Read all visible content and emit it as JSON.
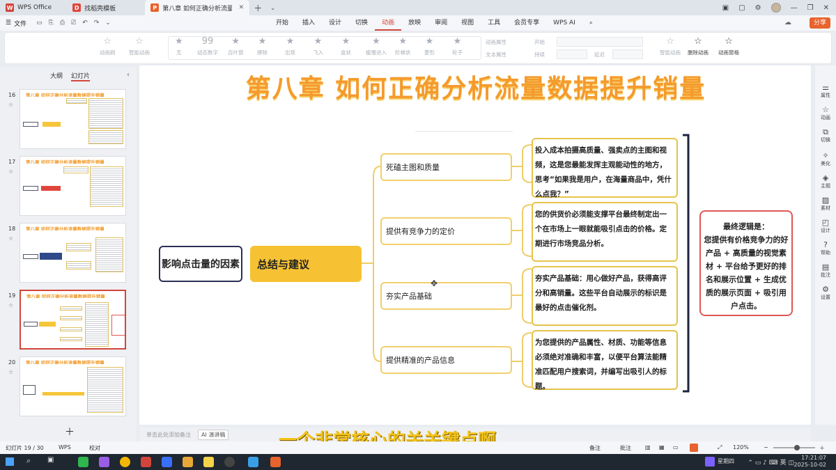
{
  "tabs": [
    {
      "label": "WPS Office",
      "logo": "W",
      "color": "#d2453a"
    },
    {
      "label": "找稻壳模板",
      "logo": "D",
      "color": "#e0453d"
    },
    {
      "label": "第八章 如何正确分析流量数据",
      "logo": "P",
      "color": "#e8632d",
      "active": true
    }
  ],
  "menu": {
    "file": "文件",
    "tabs": [
      "开始",
      "插入",
      "设计",
      "切换",
      "动画",
      "放映",
      "审阅",
      "视图",
      "工具",
      "会员专享",
      "WPS AI"
    ],
    "active": "动画",
    "share": "分享"
  },
  "ribbon": {
    "items": [
      {
        "label": "动画刷",
        "icon": "☆",
        "enabled": false
      },
      {
        "label": "智能动画",
        "icon": "☆",
        "enabled": false
      },
      {
        "label": "无",
        "icon": "☆",
        "enabled": false
      },
      {
        "label": "动态数字",
        "icon": "99",
        "enabled": false
      },
      {
        "label": "百叶窗",
        "icon": "★",
        "enabled": false
      },
      {
        "label": "擦除",
        "icon": "★",
        "enabled": false
      },
      {
        "label": "出现",
        "icon": "★",
        "enabled": false
      },
      {
        "label": "飞入",
        "icon": "★",
        "enabled": false
      },
      {
        "label": "盒状",
        "icon": "★",
        "enabled": false
      },
      {
        "label": "缓慢进入",
        "icon": "★",
        "enabled": false
      },
      {
        "label": "阶梯状",
        "icon": "★",
        "enabled": false
      },
      {
        "label": "菱形",
        "icon": "★",
        "enabled": false
      },
      {
        "label": "轮子",
        "icon": "★",
        "enabled": false
      }
    ],
    "effect_attr": "动画属性",
    "text_attr": "文本属性",
    "start": "开始",
    "duration": "持续",
    "delay": "延迟",
    "right": [
      {
        "label": "智能动画",
        "icon": "☆",
        "enabled": false
      },
      {
        "label": "删除动画",
        "icon": "☆",
        "enabled": true
      },
      {
        "label": "动画窗格",
        "icon": "☆",
        "enabled": true
      }
    ]
  },
  "leftpanel": {
    "tab_outline": "大纲",
    "tab_slides": "幻灯片",
    "thumb_title": "第八章 如何正确分析流量数据提升销量",
    "slides": [
      16,
      17,
      18,
      19,
      20
    ],
    "selected": 19
  },
  "slide": {
    "title": "第八章 如何正确分析流量数据提升销量",
    "root": "影响点击量的因素",
    "middle": "总结与建议",
    "branches": [
      {
        "label": "死磕主图和质量",
        "detail": "投入成本拍摄高质量、强卖点的主图和视频，这是您最能发挥主观能动性的地方，思考“如果我是用户，在海量商品中，凭什么点我？”"
      },
      {
        "label": "提供有竞争力的定价",
        "detail": "您的供货价必须能支撑平台最终制定出一个在市场上一眼就能吸引点击的价格。定期进行市场竞品分析。"
      },
      {
        "label": "夯实产品基础",
        "detail": "夯实产品基础：用心做好产品，获得高评分和高销量。这些平台自动展示的标识是最好的点击催化剂。"
      },
      {
        "label": "提供精准的产品信息",
        "detail": "为您提供的产品属性、材质、功能等信息必须绝对准确和丰富，以便平台算法能精准匹配用户搜索词，并编写出吸引人的标题。"
      }
    ],
    "summary_title": "最终逻辑是：",
    "summary_body": "您提供有价格竞争力的好产品 + 高质量的视觉素材 + 平台给予更好的排名和展示位置 + 生成优质的展示页面 + 吸引用户点击。"
  },
  "righttools": [
    "属性",
    "动画",
    "切换",
    "美化",
    "主题",
    "素材",
    "设计",
    "帮助",
    "批注",
    "设置"
  ],
  "notes": {
    "placeholder": "单击此处添加备注",
    "ai": "AI 演讲稿"
  },
  "subtitle": "一个非常核心的关关键点啊",
  "status": {
    "slide_info": "幻灯片 19 / 30",
    "wps": "WPS",
    "proof": "校对",
    "notes": "备注",
    "comments": "批注",
    "zoom": "120%"
  },
  "taskbar": {
    "weekday": "星期四",
    "ime": "英",
    "time": "17:21:07",
    "date": "2025-10-02"
  }
}
